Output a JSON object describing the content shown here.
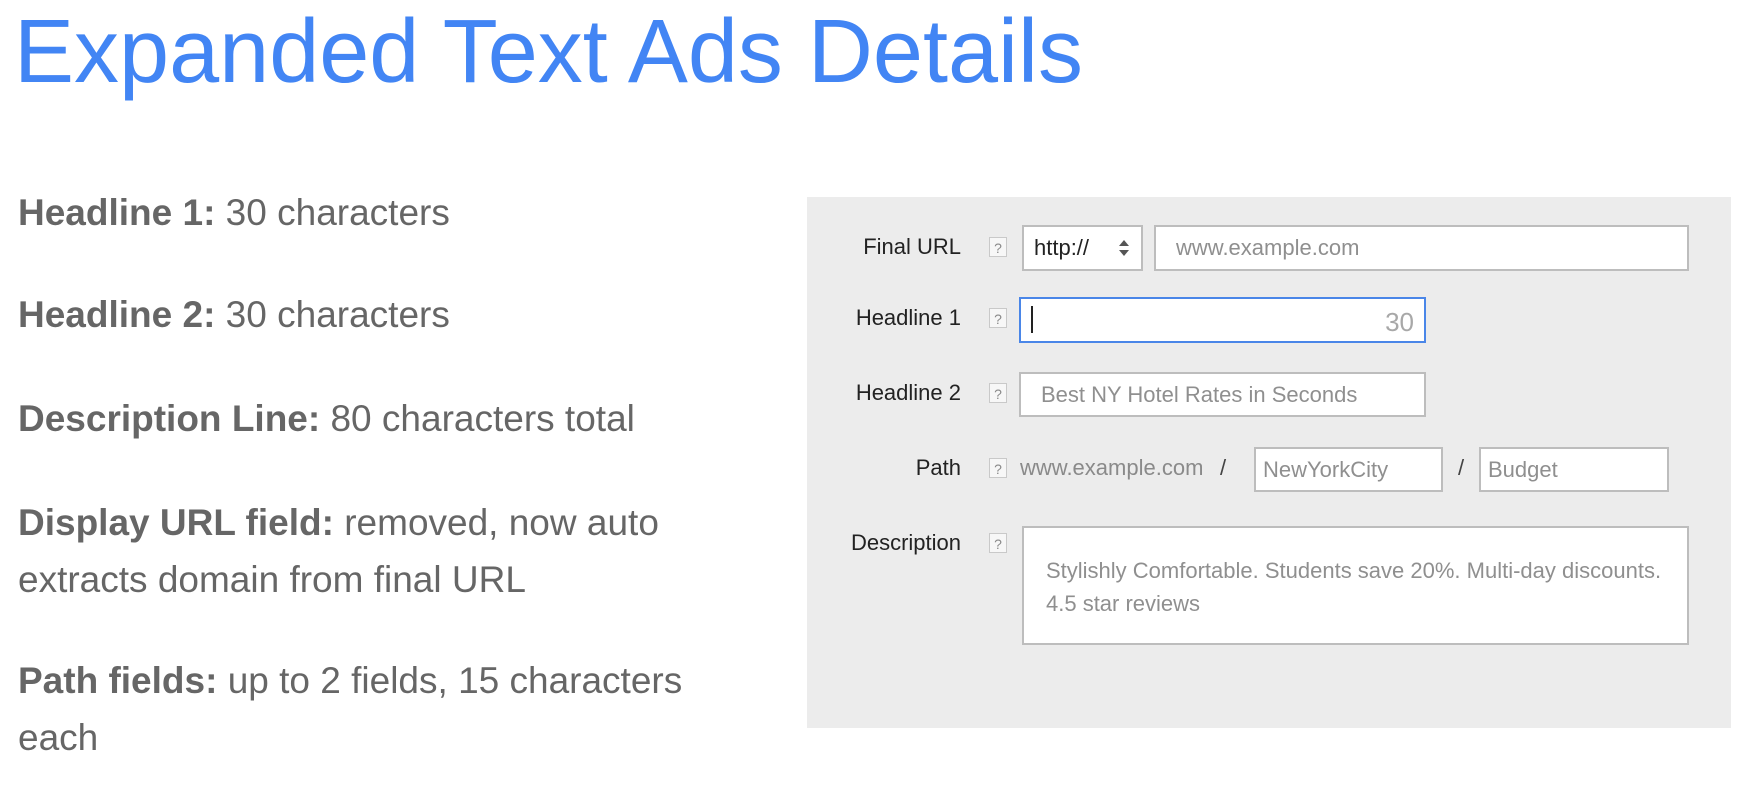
{
  "title": "Expanded Text Ads Details",
  "bullets": [
    {
      "label": "Headline 1:",
      "text": " 30 characters"
    },
    {
      "label": "Headline 2:",
      "text": " 30 characters"
    },
    {
      "label": "Description Line:",
      "text": " 80 characters total"
    },
    {
      "label": "Display URL field:",
      "text": " removed, now auto extracts domain from final URL"
    },
    {
      "label": "Path fields:",
      "text": " up to 2 fields, 15 characters each"
    }
  ],
  "form": {
    "help_glyph": "?",
    "final_url": {
      "label": "Final URL",
      "protocol": "http://",
      "placeholder": "www.example.com"
    },
    "headline1": {
      "label": "Headline 1",
      "counter": "30"
    },
    "headline2": {
      "label": "Headline 2",
      "placeholder": "Best NY Hotel Rates in Seconds"
    },
    "path": {
      "label": "Path",
      "prefix": "www.example.com",
      "separator": "/",
      "path1_placeholder": "NewYorkCity",
      "path2_placeholder": "Budget"
    },
    "description": {
      "label": "Description",
      "placeholder": "Stylishly Comfortable. Students save 20%. Multi-day discounts. 4.5 star reviews"
    }
  },
  "colors": {
    "title": "#4285f4",
    "bullet_text": "#666666",
    "panel_bg": "#ececec",
    "focus_border": "#4a86e8"
  }
}
